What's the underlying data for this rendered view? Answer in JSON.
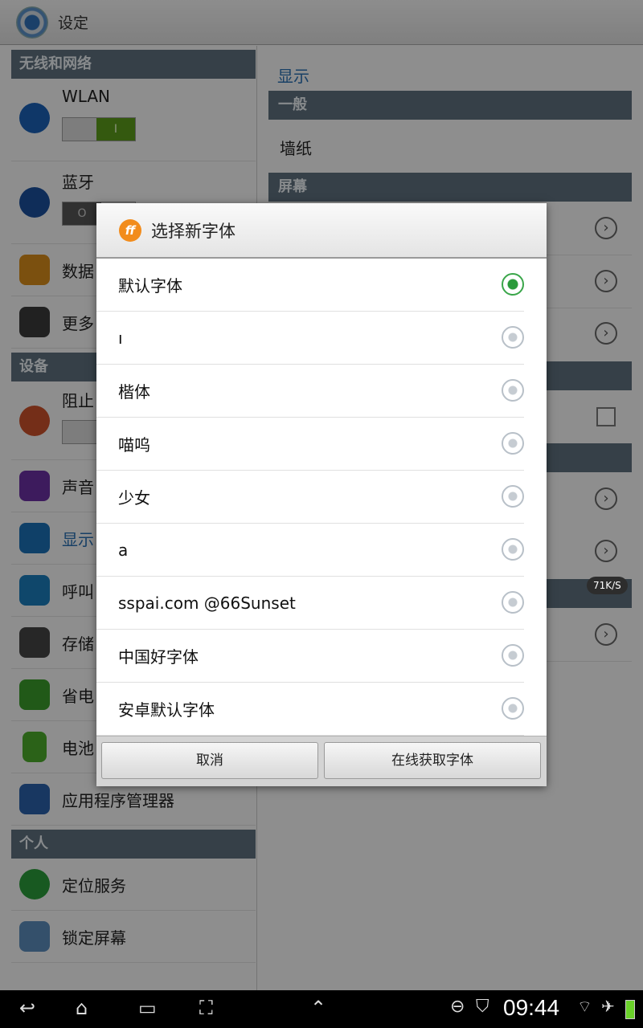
{
  "titlebar": {
    "title": "设定"
  },
  "left": {
    "sections": [
      "无线和网络",
      "设备",
      "个人"
    ],
    "items": [
      "WLAN",
      "蓝牙",
      "数据",
      "更多",
      "阻止",
      "声音",
      "显示",
      "呼叫",
      "存储",
      "省电",
      "电池",
      "应用程序管理器",
      "定位服务",
      "锁定屏幕"
    ],
    "wlan_toggle": "I",
    "bt_toggle": "O"
  },
  "right": {
    "header": "显示",
    "sections": [
      "一般",
      "屏幕"
    ],
    "wallpaper": "墙纸"
  },
  "dialog": {
    "title": "选择新字体",
    "logo": "ff",
    "options": [
      "默认字体",
      "ı",
      "楷体",
      "喵呜",
      "少女",
      "a",
      "sspai.com @66Sunset",
      "中国好字体",
      "安卓默认字体"
    ],
    "selected_index": 0,
    "cancel": "取消",
    "online": "在线获取字体"
  },
  "status": {
    "time": "09:44",
    "speed": "71K/S"
  },
  "colors": {
    "accent": "#2a6fb0",
    "section": "#5e6f7c",
    "radio_on": "#2a9a3a",
    "wlan_on": "#5a9a1a"
  }
}
